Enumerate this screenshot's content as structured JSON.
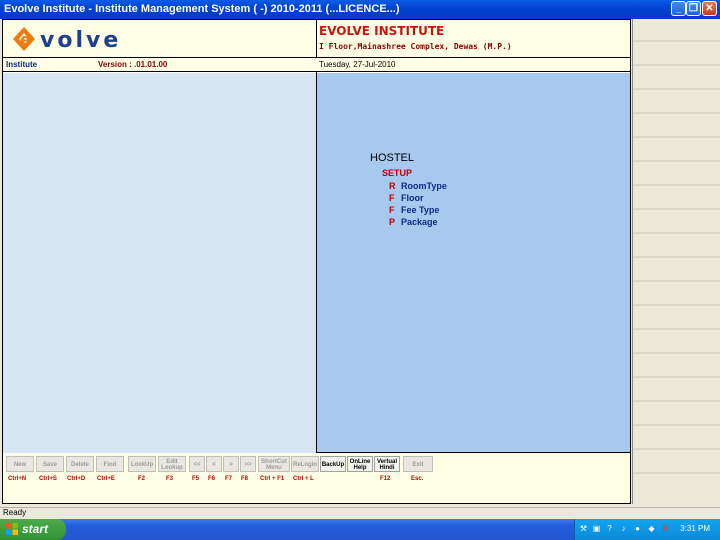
{
  "window": {
    "title": "Evolve Institute - Institute Management System ( -) 2010-2011 (...LICENCE...)",
    "minimize_glyph": "_",
    "maximize_glyph": "❐",
    "close_glyph": "✕"
  },
  "logo": {
    "text": "volve",
    "letter": "e",
    "colors": {
      "accent": "#f07a10",
      "text": "#1f3f8f"
    }
  },
  "header": {
    "institute_name": "EVOLVE INSTITUTE",
    "address": "I Floor,Mainashree Complex, Dewas (M.P.)"
  },
  "info": {
    "institute_label": "Institute",
    "version": "Version : .01.01.00",
    "date": "Tuesday, 27-Jul-2010"
  },
  "menu": {
    "title": "HOSTEL",
    "section": "SETUP",
    "items": [
      {
        "key": "R",
        "label": "RoomType"
      },
      {
        "key": "F",
        "label": "Floor"
      },
      {
        "key": "F",
        "label": "Fee Type"
      },
      {
        "key": "P",
        "label": "Package"
      }
    ]
  },
  "toolbar": {
    "buttons": [
      {
        "label": "New",
        "shortcut": "Ctrl+N",
        "enabled": false
      },
      {
        "label": "Save",
        "shortcut": "Ctrl+S",
        "enabled": false
      },
      {
        "label": "Delete",
        "shortcut": "Ctrl+D",
        "enabled": false
      },
      {
        "label": "Find",
        "shortcut": "Ctrl+E",
        "enabled": false
      },
      {
        "label": "LookUp",
        "shortcut": "F2",
        "enabled": false
      },
      {
        "label": "Edit Lookup",
        "shortcut": "F3",
        "enabled": false
      },
      {
        "label": "<<",
        "shortcut": "F5",
        "enabled": false
      },
      {
        "label": "<",
        "shortcut": "F6",
        "enabled": false
      },
      {
        "label": ">",
        "shortcut": "F7",
        "enabled": false
      },
      {
        "label": ">>",
        "shortcut": "F8",
        "enabled": false
      },
      {
        "label": "ShortCut Menu",
        "shortcut": "Ctrl + F1",
        "enabled": false
      },
      {
        "label": "ReLogin",
        "shortcut": "Ctrl + L",
        "enabled": false
      },
      {
        "label": "BackUp",
        "shortcut": "",
        "enabled": true
      },
      {
        "label": "OnLine Help",
        "shortcut": "",
        "enabled": true
      },
      {
        "label": "Vertual Hindi",
        "shortcut": "F12",
        "enabled": true
      },
      {
        "label": "Exit",
        "shortcut": "Esc.",
        "enabled": false
      }
    ]
  },
  "status": {
    "text": "Ready"
  },
  "taskbar": {
    "start_label": "start",
    "clock": "3:31 PM"
  }
}
